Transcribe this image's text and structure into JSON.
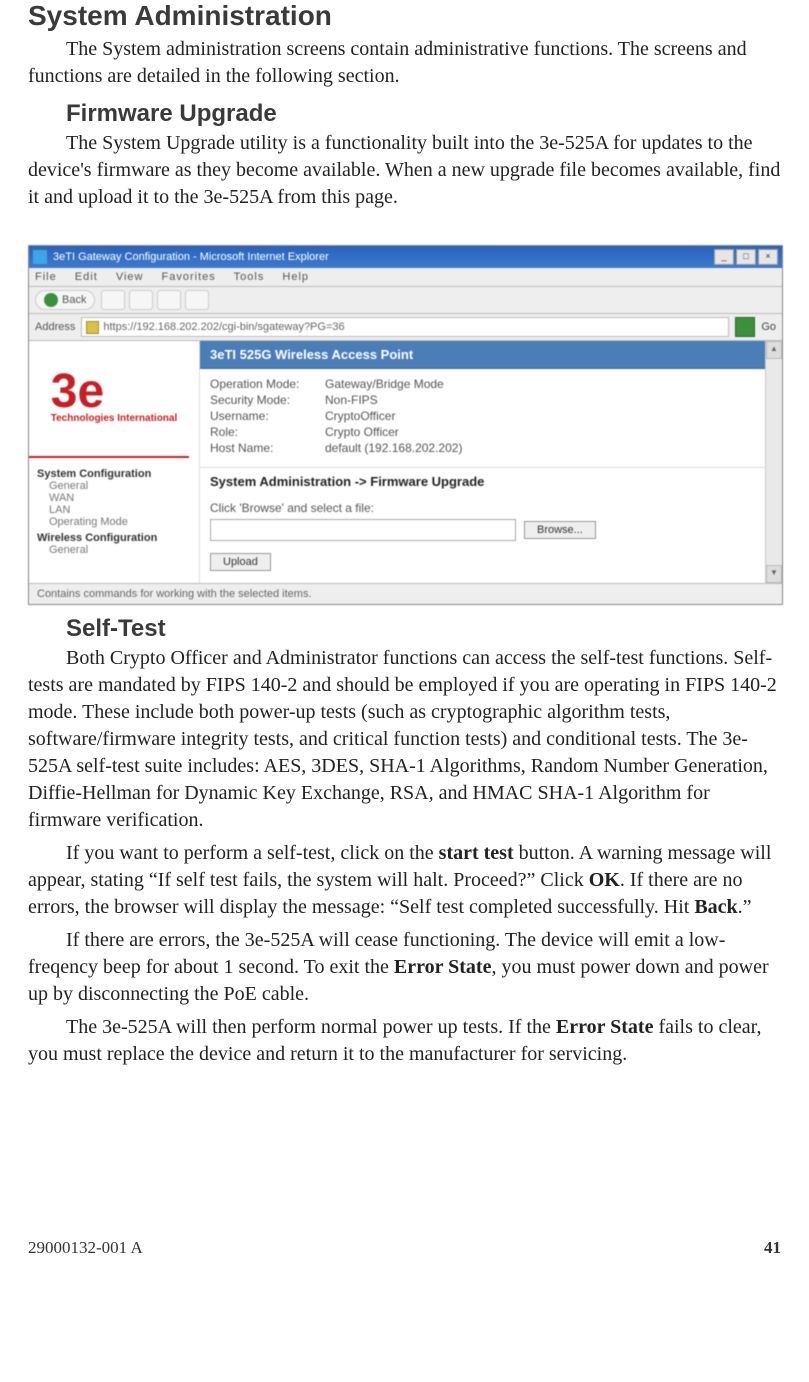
{
  "headings": {
    "sysadmin": "System Administration",
    "firmware": "Firmware Upgrade",
    "selftest": "Self-Test"
  },
  "paragraphs": {
    "p1": "The System administration screens contain administrative functions. The screens and functions are detailed in the following section.",
    "p2": "The System Upgrade utility is a functionality built into the 3e-525A for updates to the device's firmware as they become available. When a new upgrade file becomes available, find it and upload it to the 3e-525A from this page.",
    "p3": "Both Crypto Officer and Administrator functions can access the self-test functions. Self-tests are mandated by FIPS 140-2 and should be employed if you are operating in FIPS 140-2 mode. These include both power-up tests (such as cryptographic algorithm tests, software/firmware integrity tests, and critical function tests) and conditional tests. The 3e-525A self-test suite includes: AES, 3DES, SHA-1 Algorithms, Random Number Generation, Diffie-Hellman for Dynamic Key Exchange, RSA, and HMAC SHA-1 Algorithm for firmware verification.",
    "p4a": "If you want to perform a self-test, click on the ",
    "p4_start": "start test",
    "p4b": " button. A warning message will appear, stating “If self test fails, the system will halt. Proceed?” Click ",
    "p4_ok": "OK",
    "p4c": ". If there are no errors, the browser will display the message: “Self test completed successfully. Hit ",
    "p4_back": "Back",
    "p4d": ".”",
    "p5a": "If there are errors, the 3e-525A will cease functioning. The device will emit a low-freqency beep for about 1 second. To exit the ",
    "p5_err": "Error State",
    "p5b": ", you must power down and power up by disconnecting the PoE cable.",
    "p6a": "The 3e-525A will then perform normal power up tests. If the ",
    "p6_err": "Error State",
    "p6b": " fails to clear, you must replace the device and return it to the manu­facturer for servicing."
  },
  "screenshot": {
    "title": "3eTI Gateway Configuration - Microsoft Internet Explorer",
    "menu": {
      "file": "File",
      "edit": "Edit",
      "view": "View",
      "favorites": "Favorites",
      "tools": "Tools",
      "help": "Help"
    },
    "back": "Back",
    "address_label": "Address",
    "address_url": "https://192.168.202.202/cgi-bin/sgateway?PG=36",
    "go": "Go",
    "logo_main": "3e",
    "logo_sub": "Technologies International",
    "nav": {
      "group1": "System Configuration",
      "g1a": "General",
      "g1b": "WAN",
      "g1c": "LAN",
      "g1d": "Operating Mode",
      "group2": "Wireless Configuration",
      "g2a": "General"
    },
    "banner": "3eTI 525G Wireless Access Point",
    "kv": {
      "k1": "Operation Mode:",
      "v1": "Gateway/Bridge Mode",
      "k2": "Security Mode:",
      "v2": "Non-FIPS",
      "k3": "Username:",
      "v3": "CryptoOfficer",
      "k4": "Role:",
      "v4": "Crypto Officer",
      "k5": "Host Name:",
      "v5": "default (192.168.202.202)"
    },
    "sect": "System Administration -> Firmware Upgrade",
    "hint": "Click 'Browse' and select a file:",
    "browse": "Browse...",
    "upload": "Upload",
    "status": "Contains commands for working with the selected items."
  },
  "footer": {
    "docnum": "29000132-001 A",
    "page": "41"
  }
}
